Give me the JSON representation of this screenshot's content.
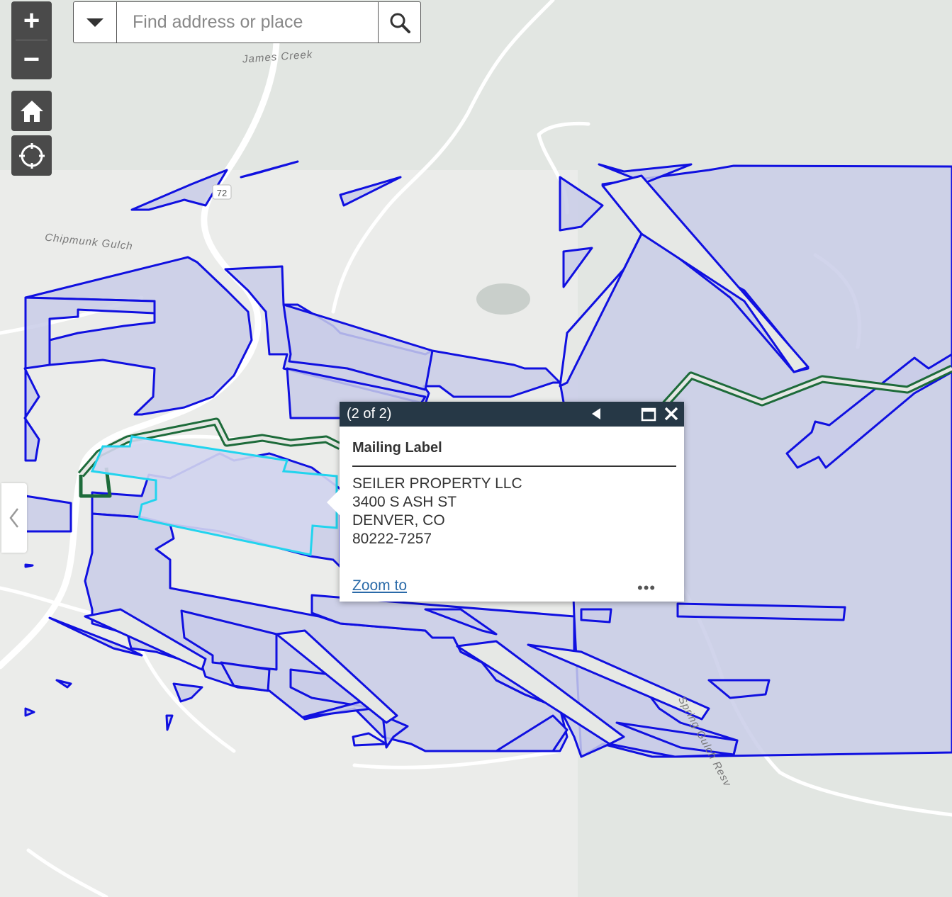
{
  "map": {
    "labels": {
      "james_creek": "James Creek",
      "chipmunk_gulch": "Chipmunk Gulch",
      "spring_gulch": "Spring Gulch Resv",
      "route": "72"
    },
    "colors": {
      "parcel_fill": "#c9cce8",
      "parcel_stroke": "#1010e0",
      "selected_stroke": "#22d4ee",
      "trail": "#1d6b3a",
      "road": "#ffffff",
      "terrain": "#e3e6e3"
    }
  },
  "controls": {
    "zoom_in": "+",
    "zoom_out": "−",
    "home_icon": "home-icon",
    "locate_icon": "locate-icon"
  },
  "search": {
    "placeholder": "Find address or place",
    "icon": "search-icon"
  },
  "popup": {
    "count": "(2 of 2)",
    "title": "Mailing Label",
    "lines": [
      "SEILER PROPERTY LLC",
      "3400 S ASH ST",
      "DENVER, CO",
      "80222-7257"
    ],
    "zoom_to": "Zoom to",
    "more": "•••"
  }
}
